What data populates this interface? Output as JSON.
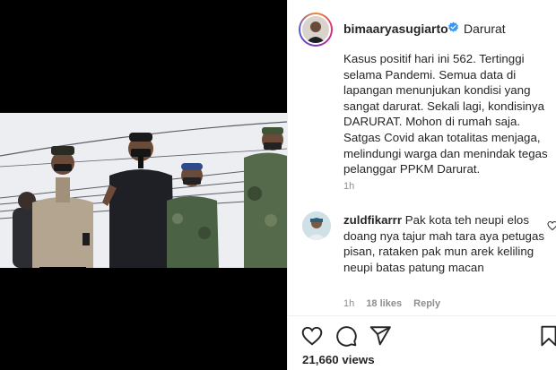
{
  "post": {
    "username": "bimaaryasugiarto",
    "verified": true,
    "header_label": "Darurat",
    "caption": "Kasus positif hari ini 562. Tertinggi selama Pandemi. Semua data di lapangan menunjukan kondisi yang sangat darurat. Sekali lagi, kondisinya DARURAT. Mohon di rumah saja. Satgas Covid akan totalitas menjaga, melindungi warga dan menindak tegas pelanggar PPKM Darurat.",
    "caption_time": "1h"
  },
  "comment": {
    "username": "zuldfikarrr",
    "text": "Pak kota teh neupi elos doang nya tajur mah tara aya petugas pisan, rataken pak mun arek keliling neupi batas patung macan",
    "time": "1h",
    "likes": "18 likes",
    "reply_label": "Reply"
  },
  "stats": {
    "views": "21,660 views"
  },
  "icons": {
    "like": "heart-icon",
    "comment": "comment-icon",
    "share": "send-icon",
    "save": "bookmark-icon",
    "verified": "verified-badge-icon"
  },
  "colors": {
    "text": "#262626",
    "muted": "#8e8e8e",
    "verified": "#3897f0",
    "media_background": "#000000"
  }
}
